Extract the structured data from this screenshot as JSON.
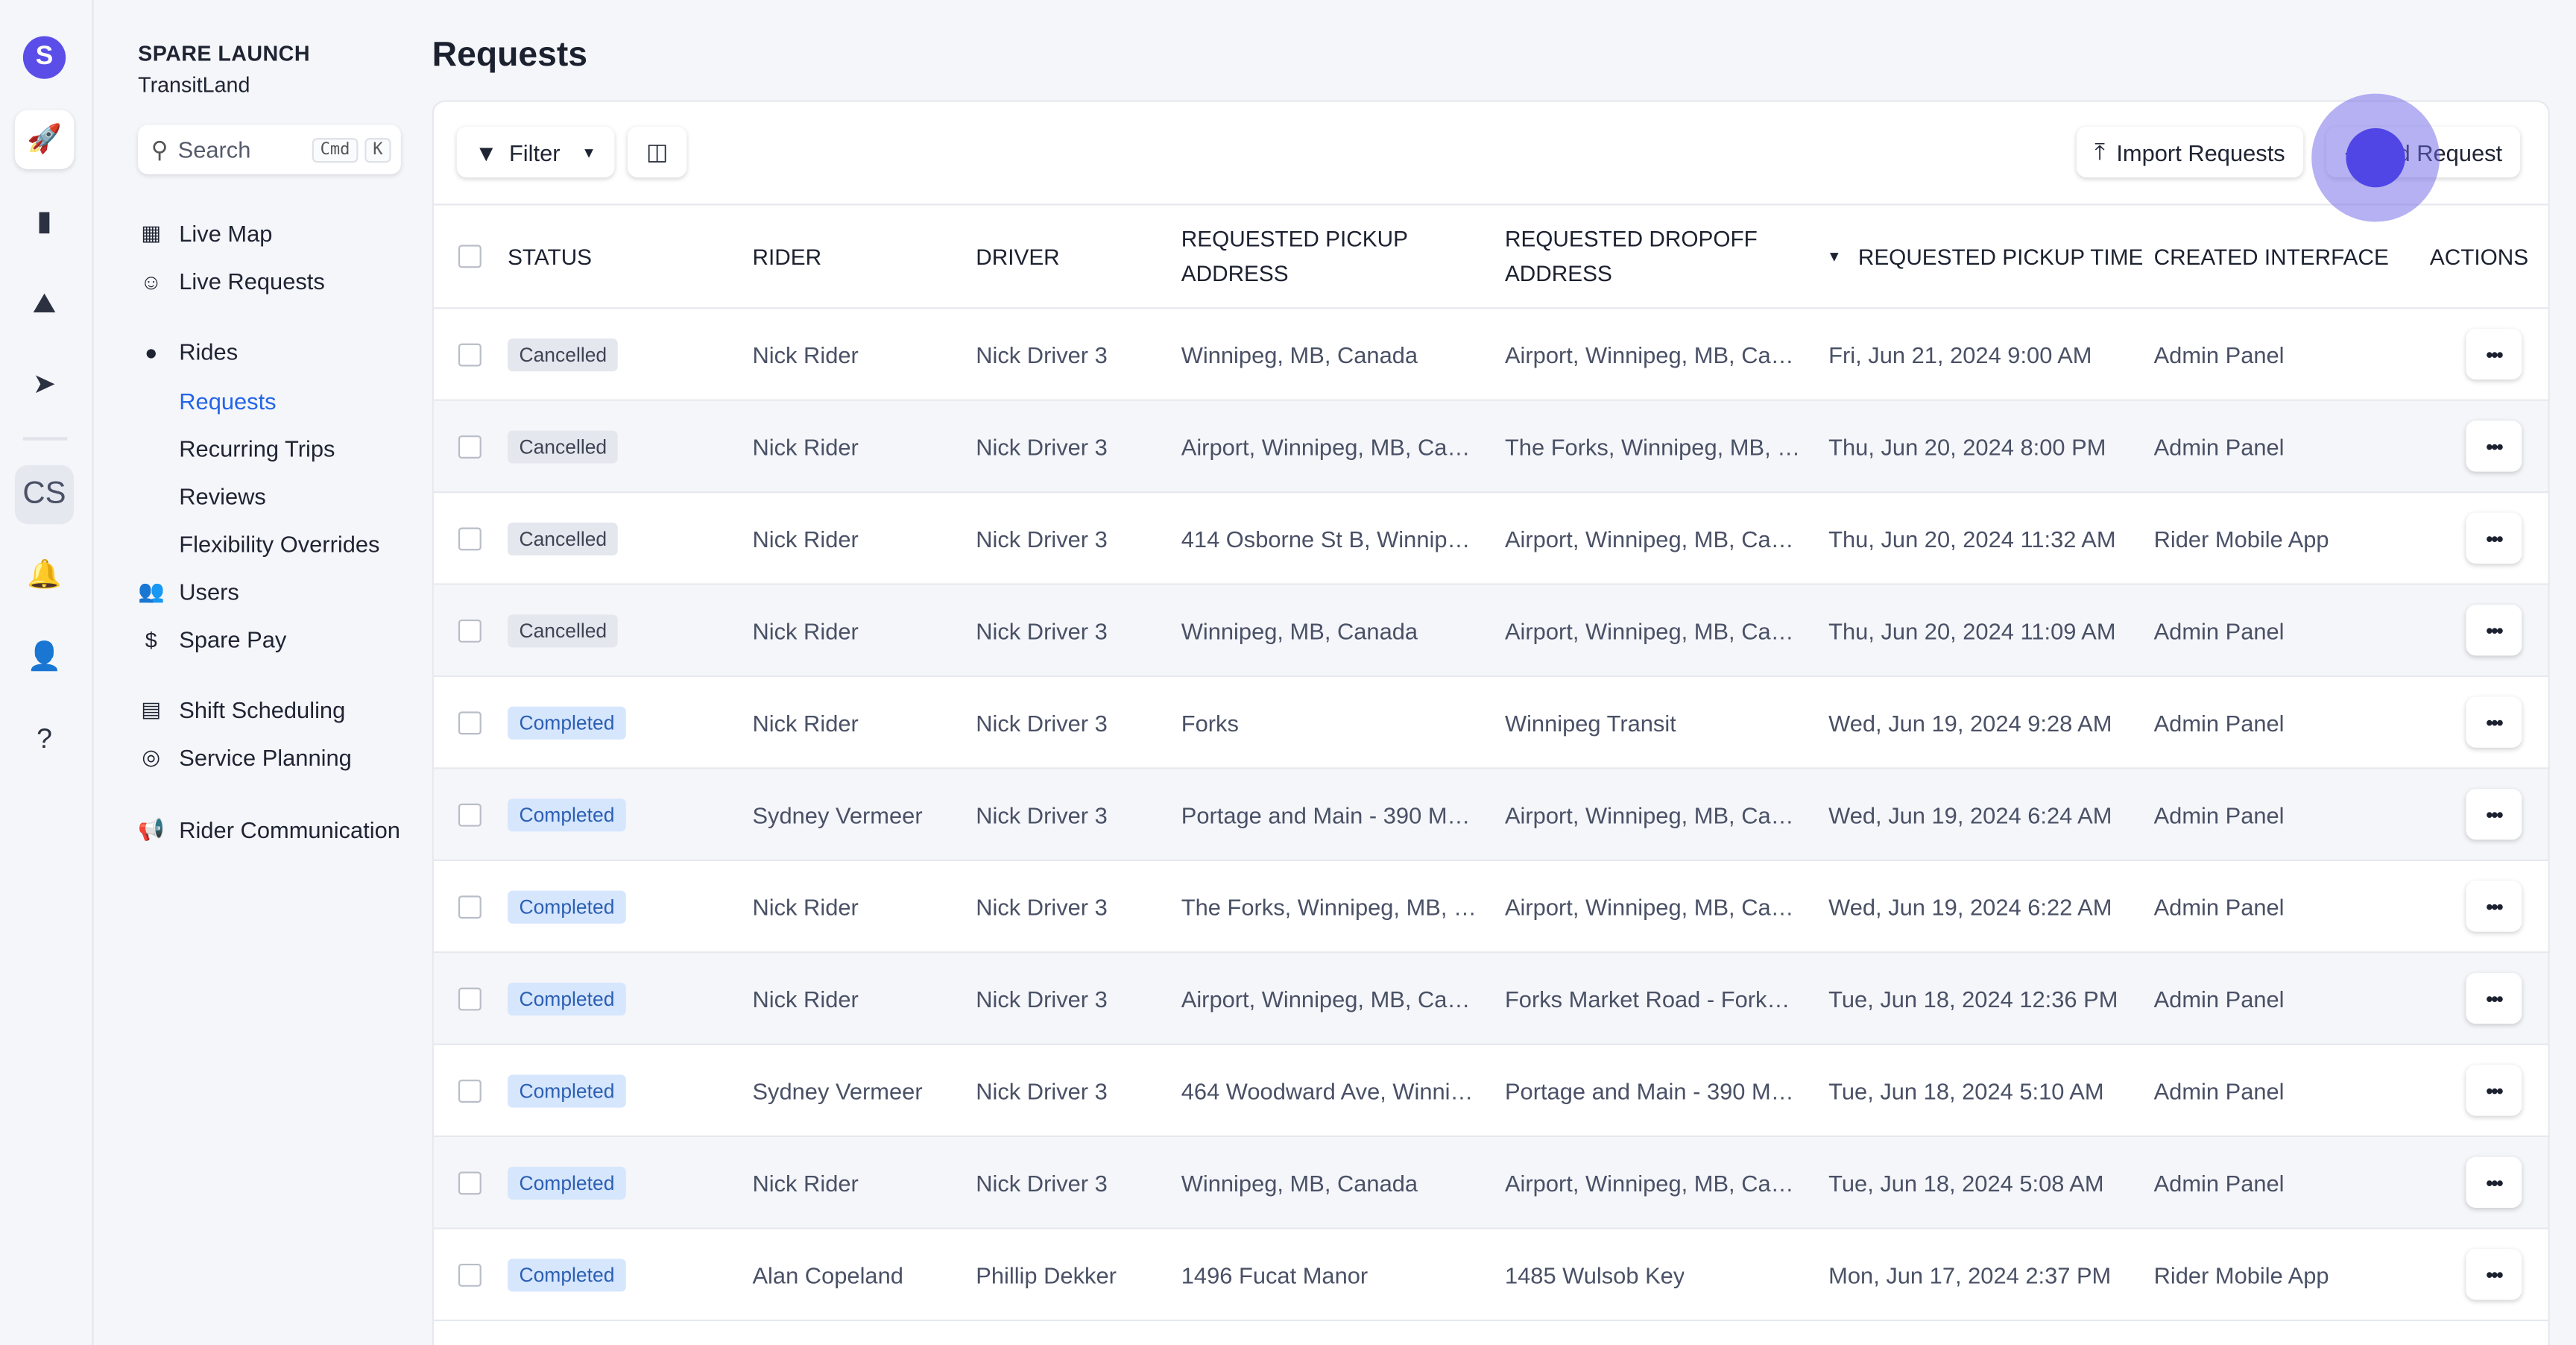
{
  "rail": {
    "logo": "S",
    "initials": "CS",
    "items": [
      "rocket-icon",
      "chart-bar-icon",
      "map-pin-icon",
      "paper-plane-icon",
      "bell-icon",
      "support-agent-icon",
      "help-icon"
    ]
  },
  "org": {
    "name": "SPARE LAUNCH",
    "sub": "TransitLand"
  },
  "search": {
    "placeholder": "Search",
    "kbd1": "Cmd",
    "kbd2": "K"
  },
  "nav": {
    "live_map": "Live Map",
    "live_requests": "Live Requests",
    "rides": "Rides",
    "requests": "Requests",
    "recurring": "Recurring Trips",
    "reviews": "Reviews",
    "flex": "Flexibility Overrides",
    "users": "Users",
    "spare_pay": "Spare Pay",
    "shift": "Shift Scheduling",
    "service": "Service Planning",
    "rider_comm": "Rider Communication"
  },
  "page": {
    "title": "Requests"
  },
  "toolbar": {
    "filter": "Filter",
    "import": "Import Requests",
    "add": "Add Request"
  },
  "table": {
    "headers": [
      "STATUS",
      "RIDER",
      "DRIVER",
      "REQUESTED PICKUP ADDRESS",
      "REQUESTED DROPOFF ADDRESS",
      "REQUESTED PICKUP TIME",
      "CREATED INTERFACE",
      "ACTIONS"
    ],
    "rows": [
      [
        "Cancelled",
        "Nick Rider",
        "Nick Driver 3",
        "Winnipeg, MB, Canada",
        "Airport, Winnipeg, MB, Can...",
        "Fri, Jun 21, 2024 9:00 AM",
        "Admin Panel"
      ],
      [
        "Cancelled",
        "Nick Rider",
        "Nick Driver 3",
        "Airport, Winnipeg, MB, Can...",
        "The Forks, Winnipeg, MB, C...",
        "Thu, Jun 20, 2024 8:00 PM",
        "Admin Panel"
      ],
      [
        "Cancelled",
        "Nick Rider",
        "Nick Driver 3",
        "414 Osborne St B, Winnipe...",
        "Airport, Winnipeg, MB, Can...",
        "Thu, Jun 20, 2024 11:32 AM",
        "Rider Mobile App"
      ],
      [
        "Cancelled",
        "Nick Rider",
        "Nick Driver 3",
        "Winnipeg, MB, Canada",
        "Airport, Winnipeg, MB, Can...",
        "Thu, Jun 20, 2024 11:09 AM",
        "Admin Panel"
      ],
      [
        "Completed",
        "Nick Rider",
        "Nick Driver 3",
        "Forks",
        "Winnipeg Transit",
        "Wed, Jun 19, 2024 9:28 AM",
        "Admin Panel"
      ],
      [
        "Completed",
        "Sydney Vermeer",
        "Nick Driver 3",
        "Portage and Main - 390 Mai...",
        "Airport, Winnipeg, MB, Can...",
        "Wed, Jun 19, 2024 6:24 AM",
        "Admin Panel"
      ],
      [
        "Completed",
        "Nick Rider",
        "Nick Driver 3",
        "The Forks, Winnipeg, MB, C...",
        "Airport, Winnipeg, MB, Can...",
        "Wed, Jun 19, 2024 6:22 AM",
        "Admin Panel"
      ],
      [
        "Completed",
        "Nick Rider",
        "Nick Driver 3",
        "Airport, Winnipeg, MB, Can...",
        "Forks Market Road - Forks ...",
        "Tue, Jun 18, 2024 12:36 PM",
        "Admin Panel"
      ],
      [
        "Completed",
        "Sydney Vermeer",
        "Nick Driver 3",
        "464 Woodward Ave, Winnip...",
        "Portage and Main - 390 Mai...",
        "Tue, Jun 18, 2024 5:10 AM",
        "Admin Panel"
      ],
      [
        "Completed",
        "Nick Rider",
        "Nick Driver 3",
        "Winnipeg, MB, Canada",
        "Airport, Winnipeg, MB, Can...",
        "Tue, Jun 18, 2024 5:08 AM",
        "Admin Panel"
      ],
      [
        "Completed",
        "Alan Copeland",
        "Phillip Dekker",
        "1496 Fucat Manor",
        "1485 Wulsob Key",
        "Mon, Jun 17, 2024 2:37 PM",
        "Rider Mobile App"
      ]
    ]
  },
  "colors": {
    "accent": "#2464e8",
    "logo": "#5b4ee8",
    "completed_bg": "#d6e6fd",
    "cancelled_bg": "#e5e7ee"
  }
}
